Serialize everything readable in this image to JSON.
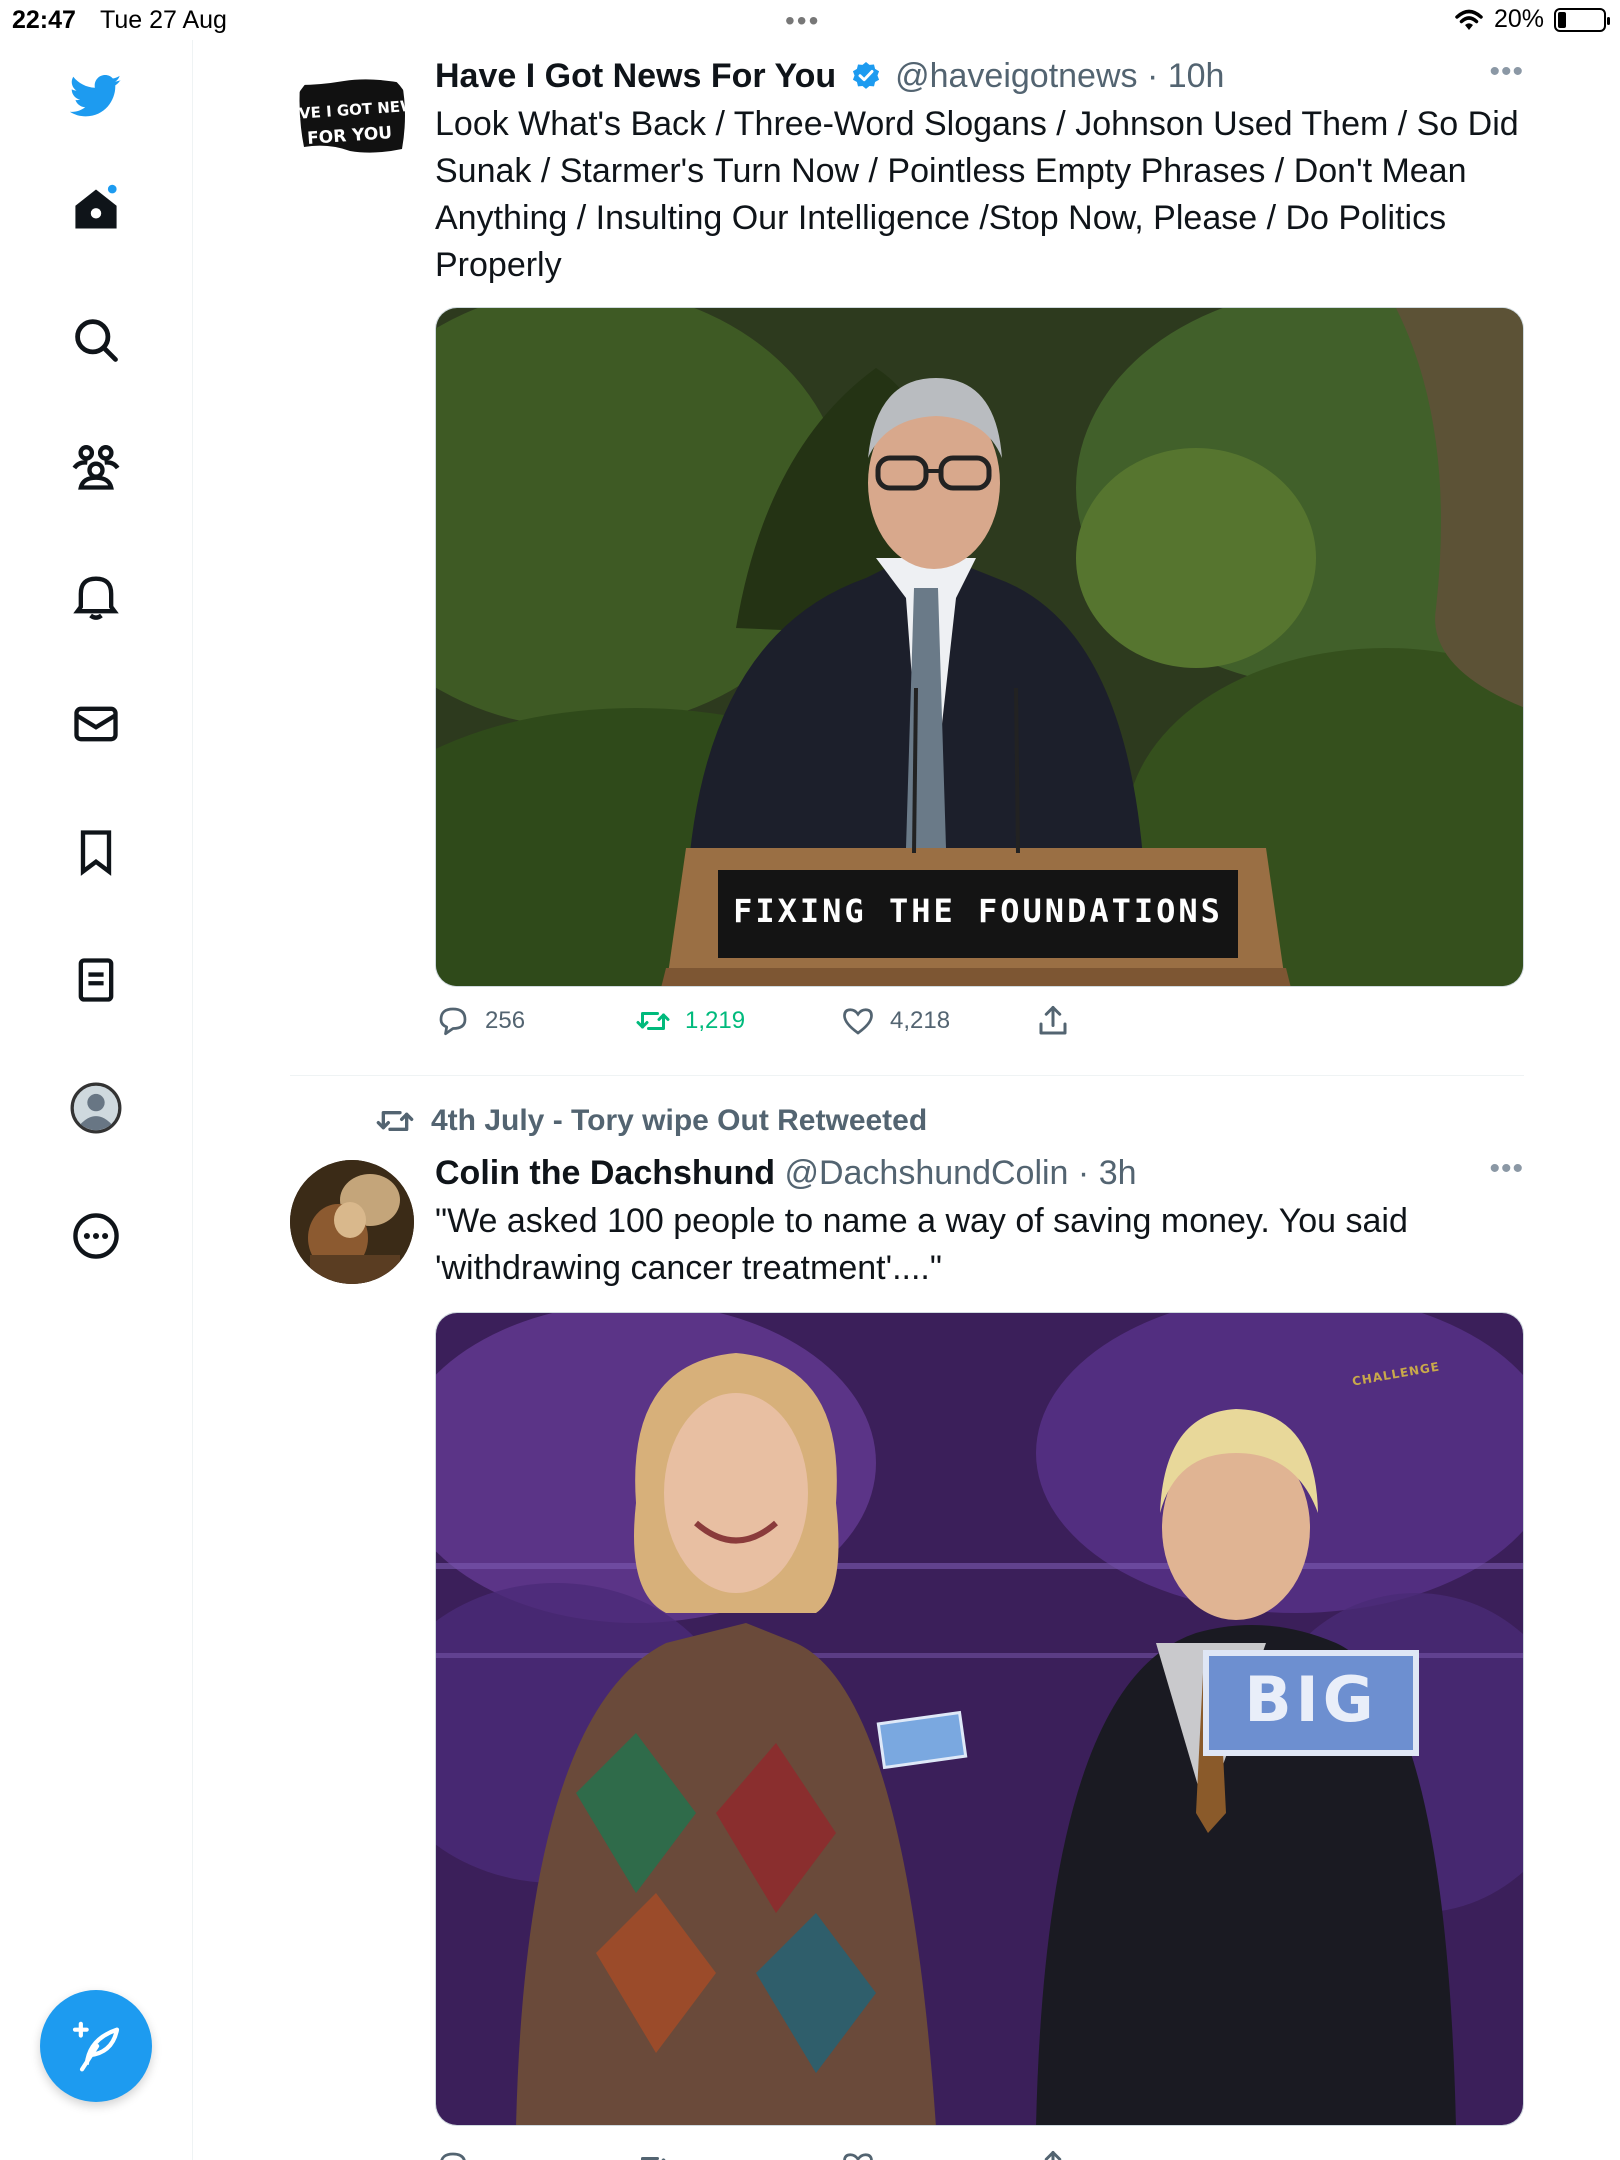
{
  "status_bar": {
    "time": "22:47",
    "date": "Tue 27 Aug",
    "battery": "20%",
    "battery_level": 0.2
  },
  "sidebar": {
    "items": [
      {
        "name": "twitter-logo",
        "icon": "bird-icon"
      },
      {
        "name": "home",
        "icon": "home-icon"
      },
      {
        "name": "explore",
        "icon": "search-icon"
      },
      {
        "name": "communities",
        "icon": "communities-icon"
      },
      {
        "name": "notifications",
        "icon": "bell-icon"
      },
      {
        "name": "messages",
        "icon": "mail-icon"
      },
      {
        "name": "bookmarks",
        "icon": "bookmark-icon"
      },
      {
        "name": "lists",
        "icon": "list-icon"
      },
      {
        "name": "profile",
        "icon": "profile-icon"
      },
      {
        "name": "more",
        "icon": "more-circle-icon"
      }
    ],
    "compose_icon": "compose-tweet-icon"
  },
  "colors": {
    "brand": "#1d9bf0",
    "text": "#0f1419",
    "secondary_text": "#536471",
    "retweet_green": "#00ba7c"
  },
  "tweets": [
    {
      "author_name": "Have I Got News For You",
      "verified": true,
      "handle": "@haveigotnews",
      "time": "10h",
      "avatar_text": "HAVE I GOT NEWS FOR YOU",
      "text": "Look What's Back / Three-Word Slogans / Johnson Used Them / So Did Sunak / Starmer's Turn Now / Pointless Empty Phrases / Don't Mean Anything / Insulting Our Intelligence /Stop Now, Please / Do Politics Properly",
      "media_text": "FIXING THE FOUNDATIONS",
      "replies": "256",
      "retweets": "1,219",
      "likes": "4,218",
      "retweeted": true
    },
    {
      "retweeted_by": "4th July - Tory wipe Out Retweeted",
      "author_name": "Colin the Dachshund",
      "handle": "@DachshundColin",
      "time": "3h",
      "text": "\"We asked 100 people to name a way of saving money.  You said 'withdrawing cancer treatment'....\"",
      "media_text": "BIG",
      "media_logo_text": "CHALLENGE"
    }
  ]
}
